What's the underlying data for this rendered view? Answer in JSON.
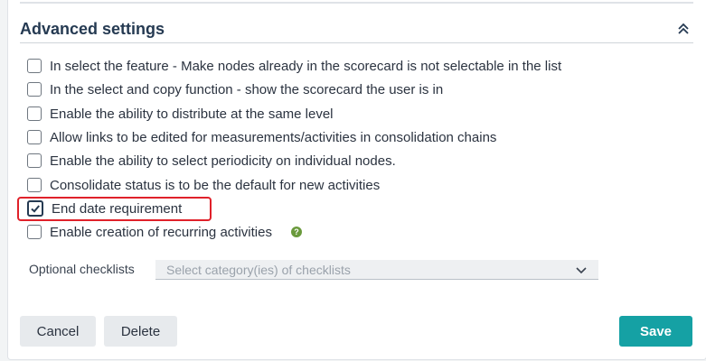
{
  "section": {
    "title": "Advanced settings"
  },
  "options": [
    {
      "label": "In select the feature - Make nodes already in the scorecard is not selectable in the list",
      "checked": false
    },
    {
      "label": "In the select and copy function - show the scorecard the user is in",
      "checked": false
    },
    {
      "label": "Enable the ability to distribute at the same level",
      "checked": false
    },
    {
      "label": "Allow links to be edited for measurements/activities in consolidation chains",
      "checked": false
    },
    {
      "label": "Enable the ability to select periodicity on individual nodes.",
      "checked": false
    },
    {
      "label": "Consolidate status is to be the default for new activities",
      "checked": false
    },
    {
      "label": "End date requirement",
      "checked": true
    },
    {
      "label": "Enable creation of recurring activities",
      "checked": false,
      "help": "?"
    }
  ],
  "checklists": {
    "label": "Optional checklists",
    "placeholder": "Select category(ies) of checklists"
  },
  "buttons": {
    "cancel": "Cancel",
    "delete": "Delete",
    "save": "Save"
  },
  "colors": {
    "primary": "#15a1a4",
    "highlight": "#e0212a",
    "title": "#253a52",
    "help": "#6a9a3c"
  }
}
